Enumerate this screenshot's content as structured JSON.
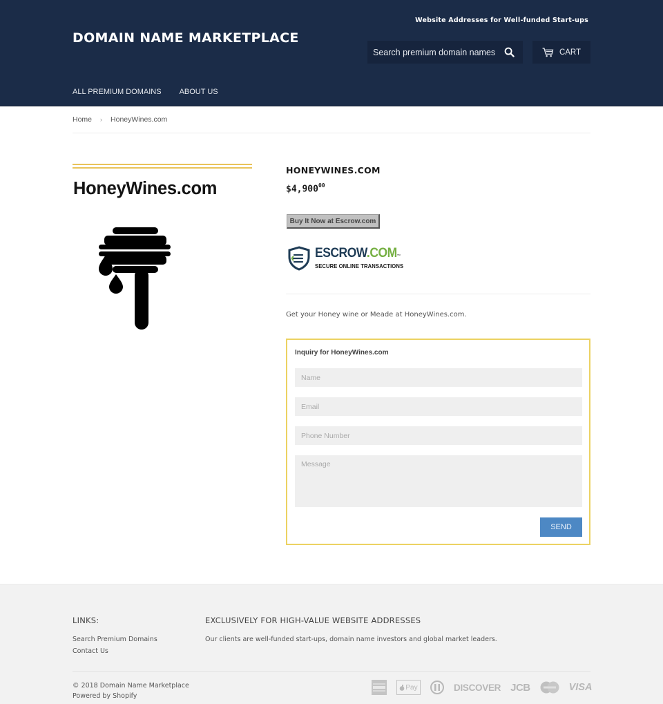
{
  "header": {
    "tagline": "Website Addresses for Well-funded Start-ups",
    "logo": "DOMAIN NAME MARKETPLACE",
    "search": {
      "placeholder": "Search premium domain names",
      "value": ""
    },
    "cart_label": "CART",
    "nav": [
      {
        "label": "ALL PREMIUM DOMAINS"
      },
      {
        "label": "ABOUT US"
      }
    ]
  },
  "breadcrumb": {
    "home": "Home",
    "separator": "›",
    "current": "HoneyWines.com"
  },
  "product": {
    "image_text": "HoneyWines.com",
    "image_icon": "honey-dipper-icon",
    "title": "HONEYWINES.COM",
    "price_main": "$4,900",
    "price_cents": "00",
    "buy_button": "Buy It Now at Escrow.com",
    "escrow": {
      "name_part1": "ESCROW",
      "name_part2": ".COM",
      "trademark": "™",
      "subtitle": "SECURE ONLINE TRANSACTIONS"
    },
    "description": "Get your Honey wine or Meade at HoneyWines.com."
  },
  "inquiry": {
    "title": "Inquiry for HoneyWines.com",
    "fields": {
      "name": {
        "placeholder": "Name",
        "value": ""
      },
      "email": {
        "placeholder": "Email",
        "value": ""
      },
      "phone": {
        "placeholder": "Phone Number",
        "value": ""
      },
      "message": {
        "placeholder": "Message",
        "value": ""
      }
    },
    "send_label": "SEND"
  },
  "footer": {
    "links_heading": "LINKS:",
    "links": [
      {
        "label": "Search Premium Domains"
      },
      {
        "label": "Contact Us"
      }
    ],
    "about_heading": "EXCLUSIVELY FOR HIGH-VALUE WEBSITE ADDRESSES",
    "about_text": "Our clients are well-funded start-ups, domain name investors and global market leaders.",
    "copyright": "© 2018 Domain Name Marketplace",
    "powered_by": "Powered by Shopify",
    "payment_methods": [
      {
        "name": "american-express",
        "label": ""
      },
      {
        "name": "apple-pay",
        "label": "Pay"
      },
      {
        "name": "diners-club",
        "label": ""
      },
      {
        "name": "discover",
        "label": "DISCOVER"
      },
      {
        "name": "jcb",
        "label": "JCB"
      },
      {
        "name": "master",
        "label": ""
      },
      {
        "name": "visa",
        "label": "VISA"
      }
    ]
  },
  "colors": {
    "header_bg": "#1b2c48",
    "accent_gold": "#ecd262",
    "send_button": "#4d88c4",
    "escrow_green": "#76b043",
    "escrow_navy": "#1f3c56"
  }
}
